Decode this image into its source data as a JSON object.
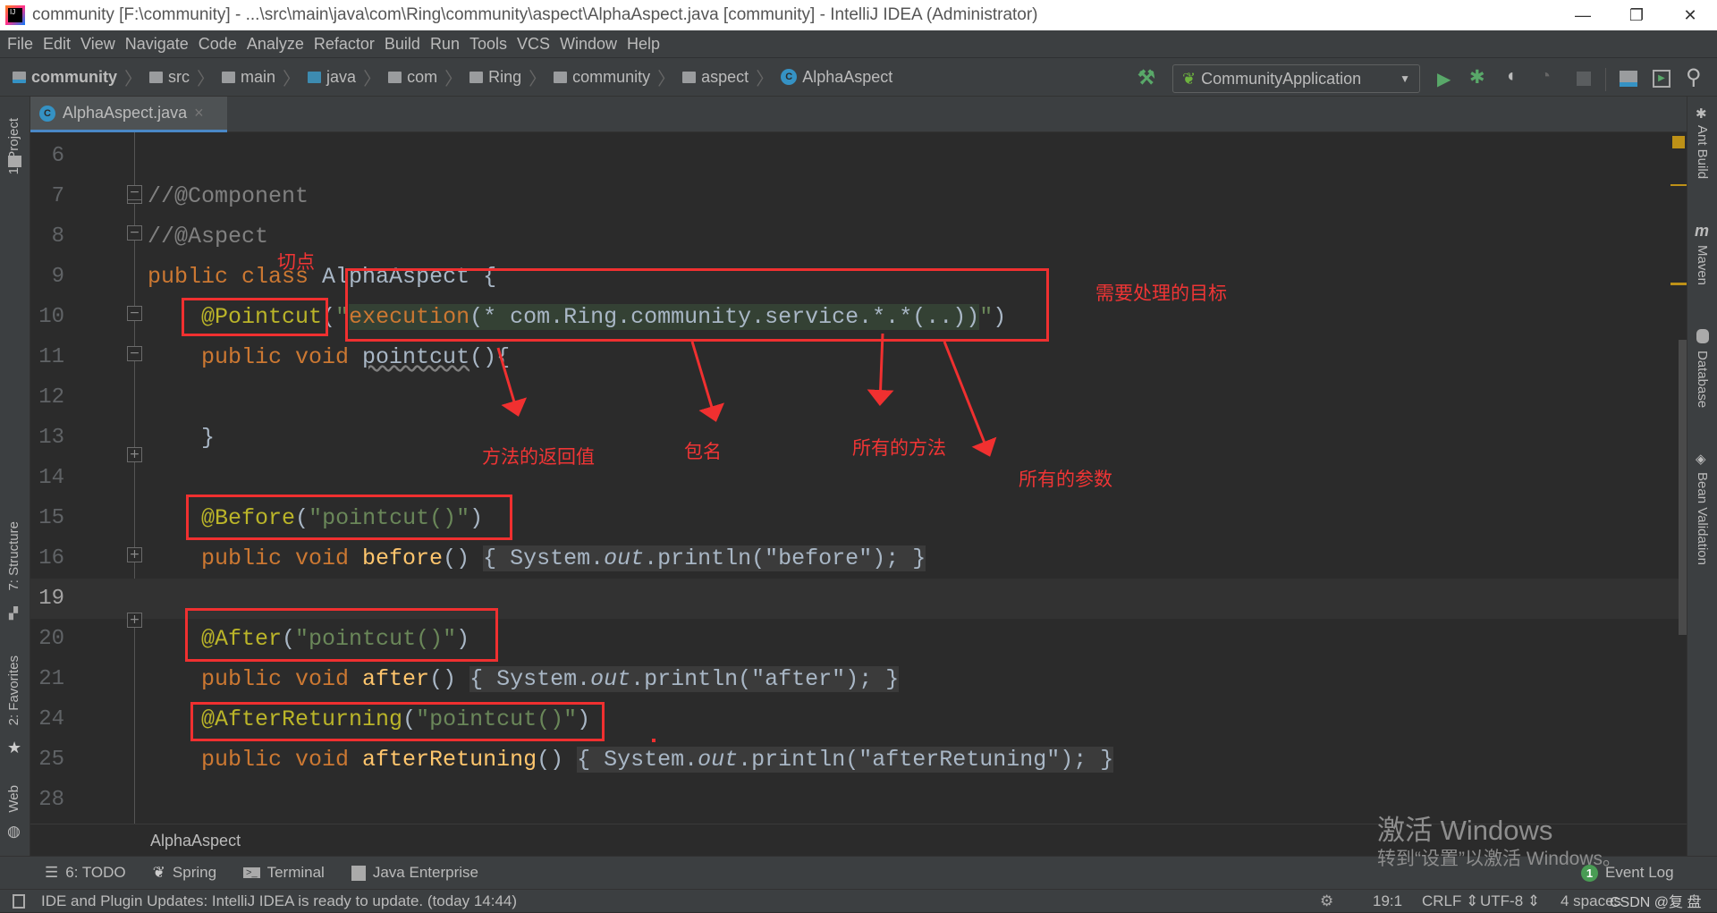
{
  "window": {
    "title": "community [F:\\community] - ...\\src\\main\\java\\com\\Ring\\community\\aspect\\AlphaAspect.java [community] - IntelliJ IDEA (Administrator)",
    "minimize": "—",
    "restore": "❐",
    "close": "✕"
  },
  "menu": [
    "File",
    "Edit",
    "View",
    "Navigate",
    "Code",
    "Analyze",
    "Refactor",
    "Build",
    "Run",
    "Tools",
    "VCS",
    "Window",
    "Help"
  ],
  "breadcrumb": [
    "community",
    "src",
    "main",
    "java",
    "com",
    "Ring",
    "community",
    "aspect",
    "AlphaAspect"
  ],
  "run_config": "CommunityApplication",
  "tab": {
    "label": "AlphaAspect.java",
    "icon_letter": "C",
    "close": "×"
  },
  "left_tools": [
    "1: Project",
    "7: Structure",
    "2: Favorites",
    "Web"
  ],
  "right_tools": [
    "Ant Build",
    "Maven",
    "Database",
    "Bean Validation"
  ],
  "code_lines": [
    {
      "n": "6",
      "tokens": []
    },
    {
      "n": "7",
      "tokens": [
        [
          "//@Component",
          "cm"
        ]
      ]
    },
    {
      "n": "8",
      "tokens": [
        [
          "//@Aspect",
          "cm"
        ]
      ]
    },
    {
      "n": "9",
      "tokens": [
        [
          "public class ",
          "kw"
        ],
        [
          "AlphaAspect {",
          "p"
        ]
      ]
    },
    {
      "n": "10",
      "tokens": [
        [
          "    ",
          "p"
        ],
        [
          "@Pointcut",
          "ann"
        ],
        [
          "(",
          "p"
        ],
        [
          "\"",
          "str"
        ],
        [
          "execution",
          "kwhl"
        ],
        [
          "(* com.Ring.community.service.*.*(..))",
          "hl"
        ],
        [
          "\"",
          "str"
        ],
        [
          ")",
          "p"
        ]
      ]
    },
    {
      "n": "11",
      "tokens": [
        [
          "    public void ",
          "kw"
        ],
        [
          "pointcut",
          "unused"
        ],
        [
          "(){",
          "p"
        ]
      ]
    },
    {
      "n": "12",
      "tokens": []
    },
    {
      "n": "13",
      "tokens": [
        [
          "    }",
          "p"
        ]
      ]
    },
    {
      "n": "14",
      "tokens": []
    },
    {
      "n": "15",
      "tokens": [
        [
          "    ",
          "p"
        ],
        [
          "@Before",
          "ann"
        ],
        [
          "(",
          "p"
        ],
        [
          "\"pointcut()\"",
          "str"
        ],
        [
          ")",
          "p"
        ]
      ]
    },
    {
      "n": "16",
      "tokens": [
        [
          "    public void ",
          "kw"
        ],
        [
          "before",
          "mth"
        ],
        [
          "() ",
          "p"
        ],
        [
          "{ ",
          "fold"
        ],
        [
          "System.",
          "fold"
        ],
        [
          "out",
          "fldf"
        ],
        [
          ".println(",
          "fold"
        ],
        [
          "\"before\"",
          "strf"
        ],
        [
          ");",
          "fold"
        ],
        [
          " }",
          "fold"
        ]
      ]
    },
    {
      "n": "19",
      "tokens": [],
      "current": true
    },
    {
      "n": "20",
      "tokens": [
        [
          "    ",
          "p"
        ],
        [
          "@After",
          "ann"
        ],
        [
          "(",
          "p"
        ],
        [
          "\"pointcut()\"",
          "str"
        ],
        [
          ")",
          "p"
        ]
      ]
    },
    {
      "n": "21",
      "tokens": [
        [
          "    public void ",
          "kw"
        ],
        [
          "after",
          "mth"
        ],
        [
          "() ",
          "p"
        ],
        [
          "{ ",
          "fold"
        ],
        [
          "System.",
          "fold"
        ],
        [
          "out",
          "fldf"
        ],
        [
          ".println(",
          "fold"
        ],
        [
          "\"after\"",
          "strf"
        ],
        [
          ");",
          "fold"
        ],
        [
          " }",
          "fold"
        ]
      ]
    },
    {
      "n": "24",
      "tokens": [
        [
          "    ",
          "p"
        ],
        [
          "@AfterReturning",
          "ann"
        ],
        [
          "(",
          "p"
        ],
        [
          "\"pointcut()\"",
          "str"
        ],
        [
          ")",
          "p"
        ]
      ]
    },
    {
      "n": "25",
      "tokens": [
        [
          "    public void ",
          "kw"
        ],
        [
          "afterRetuning",
          "mth"
        ],
        [
          "() ",
          "p"
        ],
        [
          "{ ",
          "fold"
        ],
        [
          "System.",
          "fold"
        ],
        [
          "out",
          "fldf"
        ],
        [
          ".println(",
          "fold"
        ],
        [
          "\"afterRetuning\"",
          "strf"
        ],
        [
          ");",
          "fold"
        ],
        [
          " }",
          "fold"
        ]
      ]
    },
    {
      "n": "28",
      "tokens": []
    }
  ],
  "annotations": {
    "pointcut": "切点",
    "target": "需要处理的目标",
    "return_value": "方法的返回值",
    "package": "包名",
    "all_methods": "所有的方法",
    "all_params": "所有的参数",
    "color": "#f03030"
  },
  "editor_breadcrumb": "AlphaAspect",
  "bottom_tools": [
    {
      "label": "6: TODO",
      "icon": "list-icon"
    },
    {
      "label": "Spring",
      "icon": "spring-leaf-icon"
    },
    {
      "label": "Terminal",
      "icon": "terminal-icon"
    },
    {
      "label": "Java Enterprise",
      "icon": "java-ee-icon"
    }
  ],
  "event_log": {
    "count": "1",
    "label": "Event Log"
  },
  "status": {
    "message": "IDE and Plugin Updates: IntelliJ IDEA is ready to update. (today 14:44)",
    "position": "19:1",
    "line_sep": "CRLF",
    "encoding": "UTF-8",
    "indent": "4 spaces"
  },
  "watermark": {
    "line1": "激活 Windows",
    "line2": "转到“设置”以激活 Windows。",
    "csdn": "CSDN @复 盘"
  }
}
